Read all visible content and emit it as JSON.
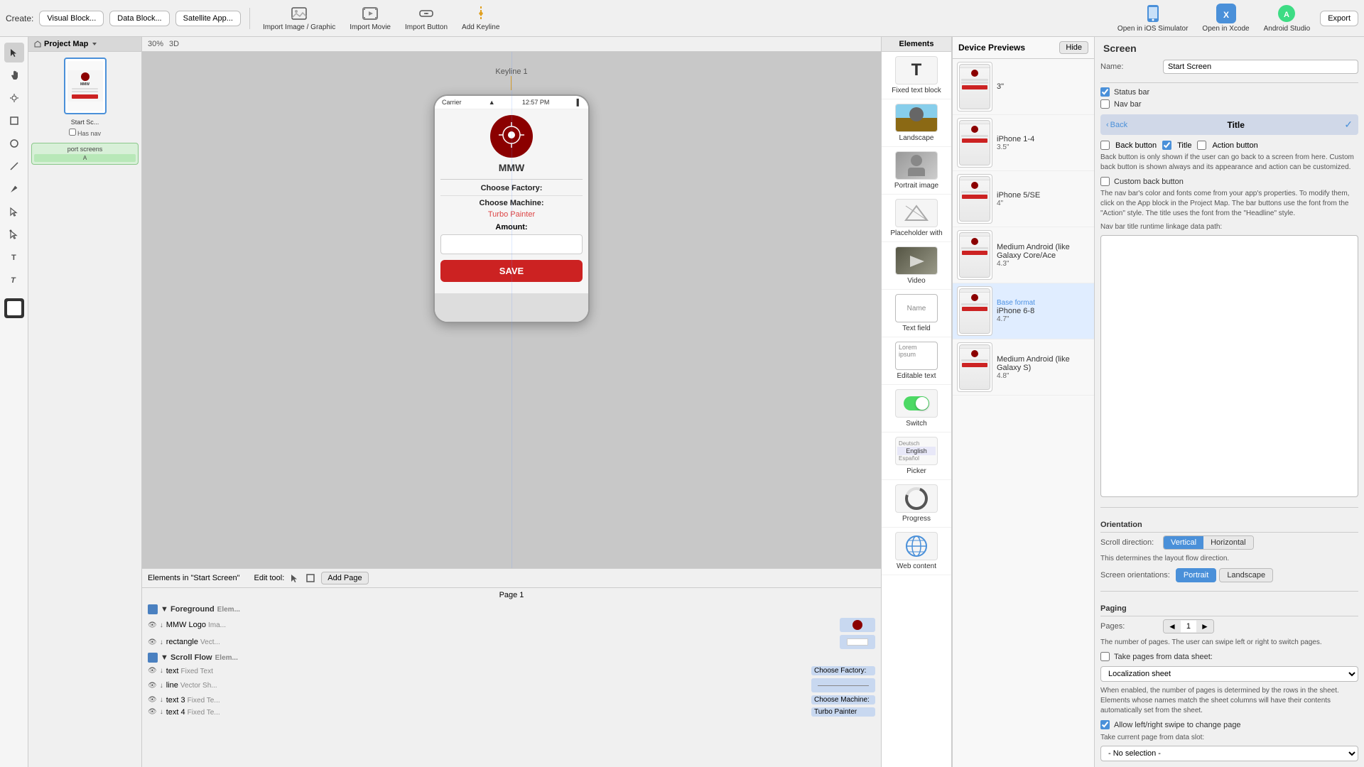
{
  "toolbar": {
    "create_label": "Create:",
    "visual_block_btn": "Visual Block...",
    "data_block_btn": "Data Block...",
    "satellite_app_btn": "Satellite App...",
    "import_image_btn": "Import Image / Graphic",
    "import_movie_btn": "Import Movie",
    "import_button_btn": "Import Button",
    "add_keyline_btn": "Add Keyline",
    "open_ios_btn": "Open in iOS Simulator",
    "open_xcode_btn": "Open in Xcode",
    "android_studio_btn": "Android Studio",
    "export_btn": "Export"
  },
  "left_tools": [
    "cursor",
    "hand",
    "pen",
    "rect",
    "circle",
    "line",
    "paint",
    "select2",
    "select3",
    "text",
    "text2"
  ],
  "project_map": {
    "title": "Project Map",
    "screen_name": "Start Sc...",
    "has_nav_label": "Has nav"
  },
  "canvas": {
    "keyline_label": "Keyline 1",
    "zoom_label": "30%",
    "three_d_label": "3D",
    "phone": {
      "carrier": "Carrier",
      "time": "12:57 PM",
      "brand": "MMW",
      "choose_factory": "Choose Factory:",
      "choose_machine": "Choose Machine:",
      "machine_value": "Turbo Painter",
      "amount_label": "Amount:",
      "save_btn": "SAVE"
    }
  },
  "bottom_panel": {
    "elements_in_label": "Elements in \"Start Screen\"",
    "edit_tool_label": "Edit tool:",
    "add_page_btn": "Add Page",
    "page_label": "Page 1",
    "groups": [
      {
        "name": "Foreground",
        "type": "Elem...",
        "items": [
          {
            "type": "MMW Logo",
            "kind": "Ima...",
            "value": ""
          },
          {
            "type": "rectangle",
            "kind": "Vect...",
            "value": ""
          }
        ]
      },
      {
        "name": "Scroll Flow",
        "type": "Elem...",
        "items": [
          {
            "type": "text",
            "kind": "Fixed Text",
            "value": "Choose Factory:"
          },
          {
            "type": "line",
            "kind": "Vector Sh...",
            "value": ""
          },
          {
            "type": "text 3",
            "kind": "Fixed Te...",
            "value": "Choose Machine:"
          },
          {
            "type": "text 4",
            "kind": "Fixed Te...",
            "value": "Turbo Painter"
          }
        ]
      }
    ]
  },
  "elements_panel": {
    "title": "Elements",
    "items": [
      {
        "name": "Fixed text block",
        "icon": "T"
      },
      {
        "name": "Landscape",
        "icon": "🏔"
      },
      {
        "name": "Portrait image",
        "icon": "👤"
      },
      {
        "name": "Placeholder with",
        "icon": "◇"
      },
      {
        "name": "Video",
        "icon": "▶"
      },
      {
        "name": "Text field",
        "icon": "Name"
      },
      {
        "name": "Editable text",
        "icon": "Lorem ipsum"
      },
      {
        "name": "Switch",
        "icon": "⚙"
      },
      {
        "name": "Picker",
        "icon": "☰"
      },
      {
        "name": "Progress",
        "icon": "◷"
      },
      {
        "name": "Web content",
        "icon": "🌐"
      }
    ]
  },
  "device_previews": {
    "title": "Device Previews",
    "hide_btn": "Hide",
    "devices": [
      {
        "name": "3\"",
        "size": "",
        "is_base": false
      },
      {
        "name": "iPhone 1-4",
        "size": "3.5\"",
        "is_base": false
      },
      {
        "name": "iPhone 5/SE",
        "size": "4\"",
        "is_base": false
      },
      {
        "name": "Medium Android (like Galaxy Core/Ace",
        "size": "4.3\"",
        "is_base": false
      },
      {
        "name": "iPhone 6-8",
        "size": "4.7\"",
        "is_base": true
      },
      {
        "name": "Medium Android (like Galaxy S)",
        "size": "4.8\"",
        "is_base": false
      }
    ],
    "base_format_label": "Base format",
    "iphone_label": "iPhone"
  },
  "right_panel": {
    "title": "Screen",
    "name_label": "Name:",
    "name_value": "Start Screen",
    "status_bar_label": "Status bar",
    "nav_bar_label": "Nav bar",
    "back_btn_label": "Back button",
    "title_label": "Title",
    "action_btn_label": "Action button",
    "nav_preview": {
      "back": "Back",
      "title": "Title"
    },
    "custom_back_label": "Custom back button",
    "nav_info": "Back button is only shown if the user can go back to a screen from here. Custom back button is shown always and its appearance and action can be customized.",
    "nav_color_info": "The nav bar's color and fonts come from your app's properties. To modify them, click on the App block in the Project Map. The bar buttons use the font from the \"Action\" style. The title uses the font from the \"Headline\" style.",
    "nav_title_path_label": "Nav bar title runtime linkage data path:",
    "orientation_label": "Orientation",
    "scroll_dir_label": "Scroll direction:",
    "vertical_btn": "Vertical",
    "horizontal_btn": "Horizontal",
    "scroll_info": "This determines the layout flow direction.",
    "screen_orient_label": "Screen orientations:",
    "portrait_btn": "Portrait",
    "landscape_btn": "Landscape",
    "paging_label": "Paging",
    "pages_label": "Pages:",
    "pages_value": "1",
    "pages_info": "The number of pages. The user can swipe left or right to switch pages.",
    "take_pages_label": "Take pages from data sheet:",
    "localization_sheet_label": "Localization sheet",
    "take_pages_info": "When enabled, the number of pages is determined by the rows in the sheet. Elements whose names match the sheet columns will have their contents automatically set from the sheet.",
    "allow_swipe_label": "Allow left/right swipe to change page",
    "current_page_label": "Take current page from data slot:",
    "no_selection_label": "- No selection -"
  }
}
